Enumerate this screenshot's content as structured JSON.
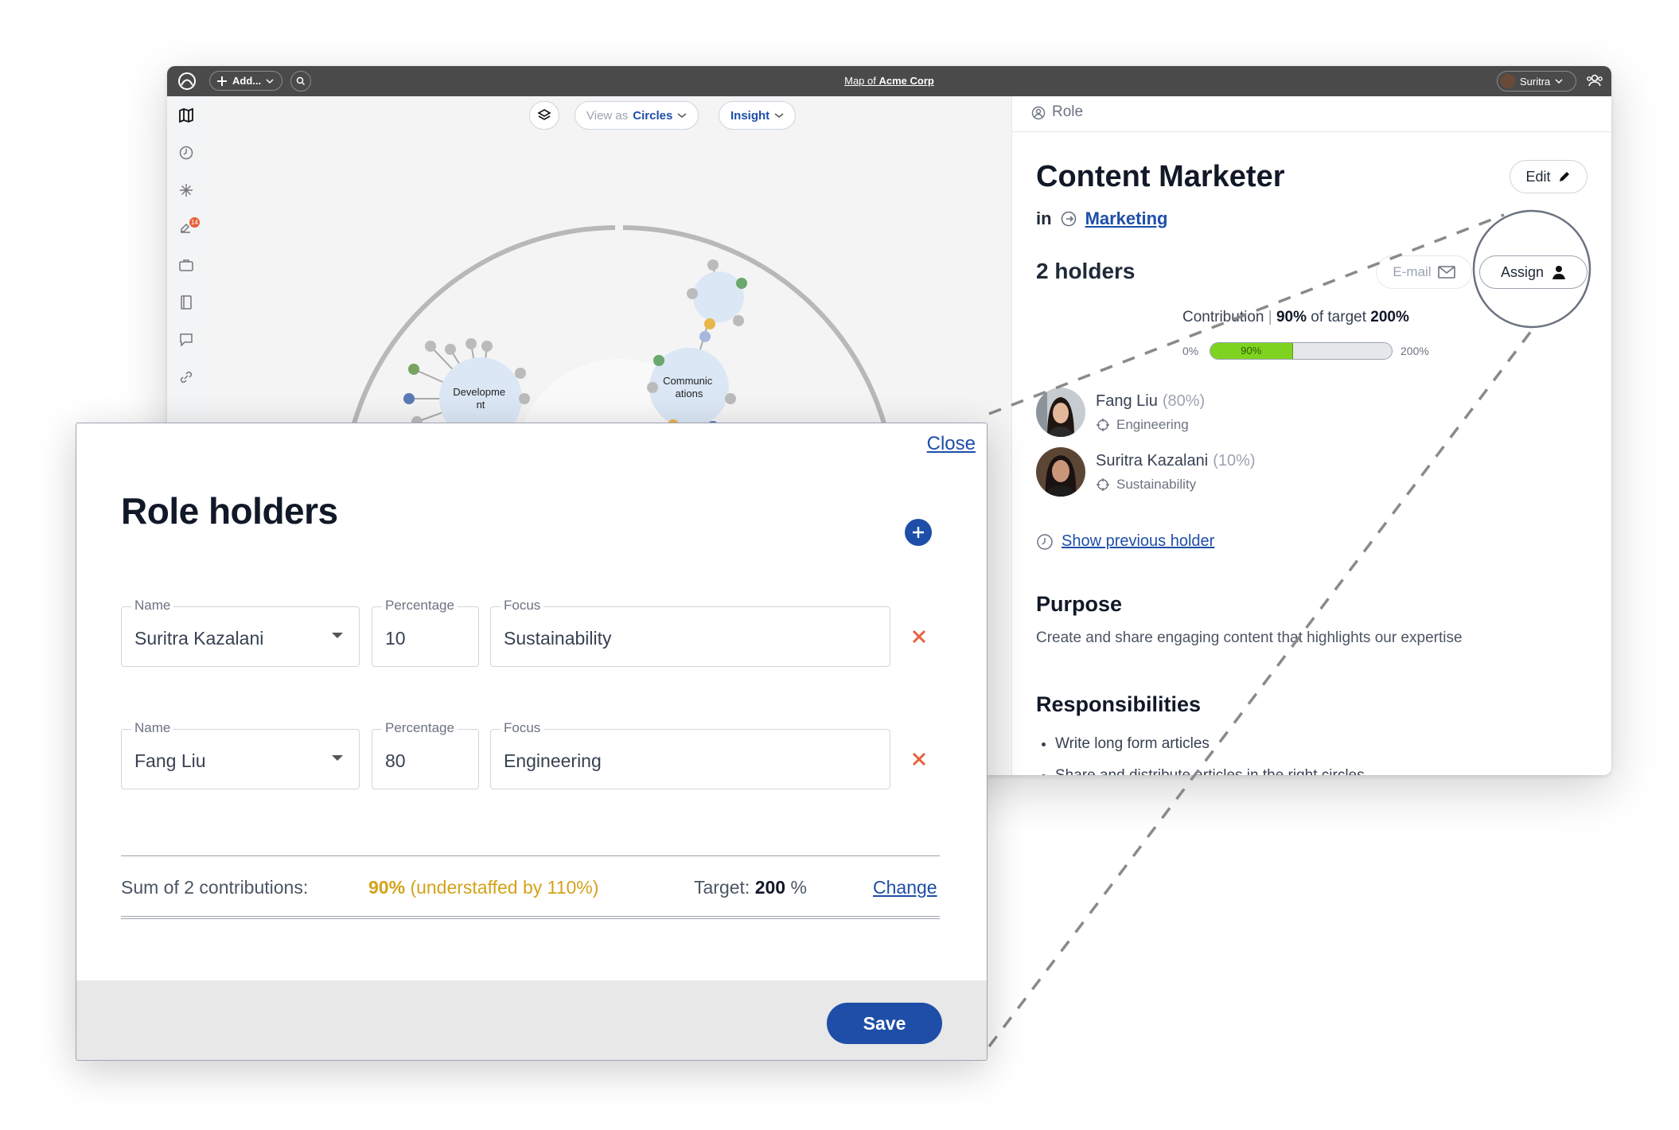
{
  "topbar": {
    "add_label": "Add...",
    "map_title_prefix": "Map of",
    "map_title_org": "Acme Corp",
    "user_name": "Suritra"
  },
  "map": {
    "view_as_label": "View as",
    "view_as_value": "Circles",
    "insight_label": "Insight",
    "circles": [
      {
        "label": "Developme\nnt"
      },
      {
        "label": "Communic\nations"
      }
    ],
    "notification_count": "14"
  },
  "panel": {
    "type_label": "Role",
    "role_title": "Content Marketer",
    "edit_label": "Edit",
    "in_label": "in",
    "parent_circle": "Marketing",
    "holders_heading": "2 holders",
    "email_label": "E-mail",
    "assign_label": "Assign",
    "contribution_label": "Contribution",
    "contribution_value": "90%",
    "contribution_mid": "of target",
    "contribution_target": "200%",
    "bar_min": "0%",
    "bar_max": "200%",
    "bar_value_label": "90%",
    "bar_fraction": 0.45,
    "holders": [
      {
        "name": "Fang Liu",
        "pct": "(80%)",
        "focus": "Engineering"
      },
      {
        "name": "Suritra Kazalani",
        "pct": "(10%)",
        "focus": "Sustainability"
      }
    ],
    "show_previous": "Show previous holder",
    "purpose_heading": "Purpose",
    "purpose_text": "Create and share engaging content that highlights our expertise",
    "responsibilities_heading": "Responsibilities",
    "responsibilities": [
      "Write long form articles",
      "Share and distribute articles in the right circles"
    ]
  },
  "modal": {
    "close_label": "Close",
    "title": "Role holders",
    "rows": [
      {
        "name_label": "Name",
        "name": "Suritra Kazalani",
        "pct_label": "Percentage",
        "pct": "10",
        "focus_label": "Focus",
        "focus": "Sustainability"
      },
      {
        "name_label": "Name",
        "name": "Fang Liu",
        "pct_label": "Percentage",
        "pct": "80",
        "focus_label": "Focus",
        "focus": "Engineering"
      }
    ],
    "sum_label": "Sum of 2 contributions:",
    "sum_value": "90%",
    "sum_note": "(understaffed by 110%)",
    "target_label": "Target:",
    "target_value": "200",
    "target_unit": "%",
    "change_label": "Change",
    "save_label": "Save"
  },
  "colors": {
    "accent": "#1e4ea8",
    "progress": "#7ed321",
    "warning": "#d4a21a",
    "danger": "#e8603c",
    "topbar": "#4a4a4a"
  }
}
